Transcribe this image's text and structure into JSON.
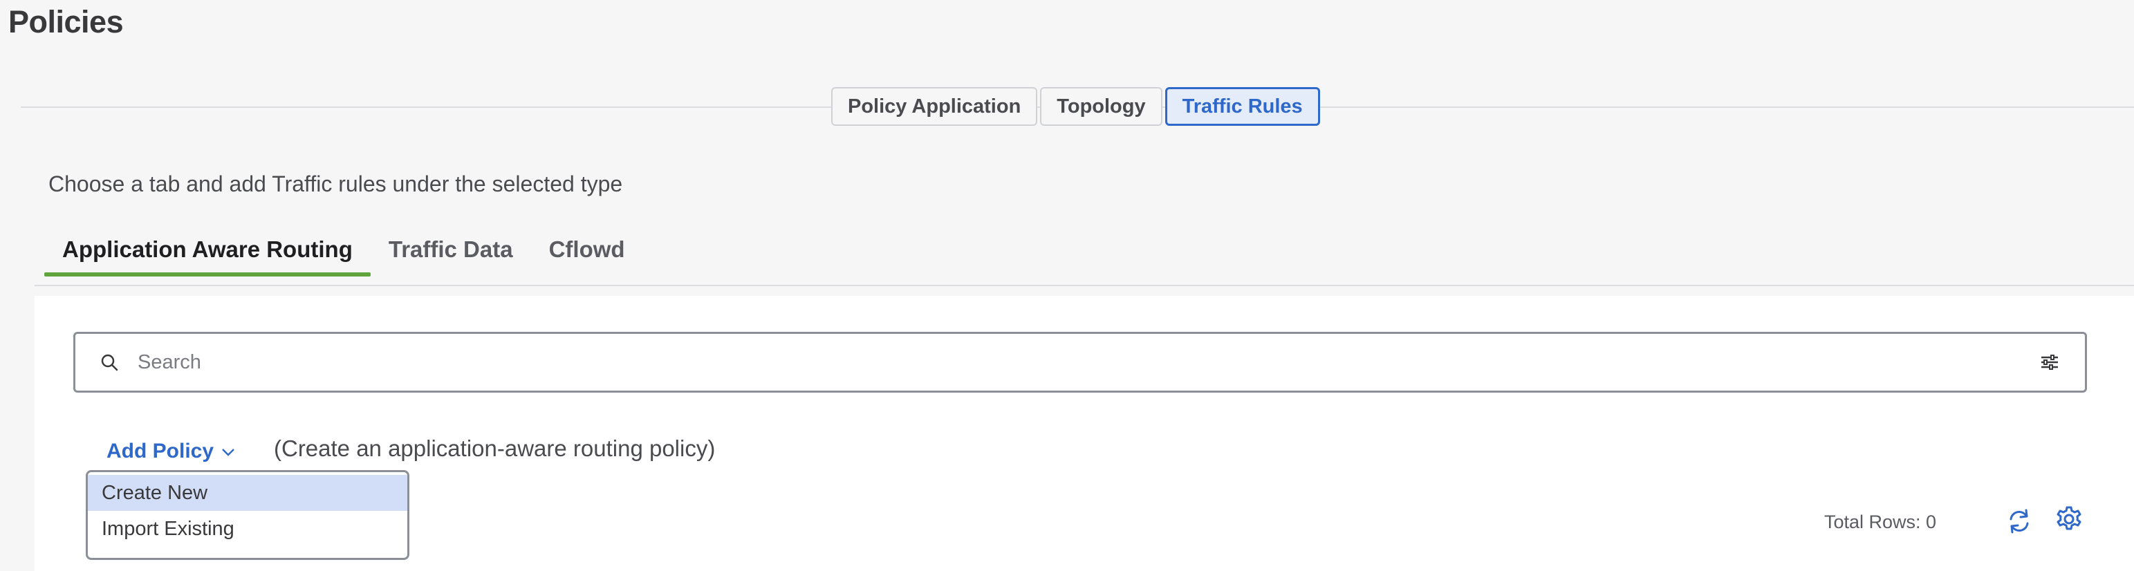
{
  "page": {
    "title": "Policies"
  },
  "segments": [
    {
      "label": "Policy Application",
      "active": false
    },
    {
      "label": "Topology",
      "active": false
    },
    {
      "label": "Traffic Rules",
      "active": true
    }
  ],
  "instructions": "Choose a tab and add Traffic rules under the selected type",
  "subtabs": [
    {
      "label": "Application Aware Routing",
      "active": true
    },
    {
      "label": "Traffic Data",
      "active": false
    },
    {
      "label": "Cflowd",
      "active": false
    }
  ],
  "search": {
    "placeholder": "Search",
    "value": ""
  },
  "add_policy": {
    "label": "Add Policy",
    "description": "(Create an application-aware routing policy)",
    "menu": [
      {
        "label": "Create New",
        "highlighted": true
      },
      {
        "label": "Import Existing",
        "highlighted": false
      }
    ]
  },
  "table": {
    "total_rows": "Total Rows: 0"
  },
  "icons": {
    "search": "search-icon",
    "filter": "filter-icon",
    "chevron": "chevron-down-icon",
    "refresh": "refresh-icon",
    "settings": "gear-icon"
  },
  "colors": {
    "accent": "#2e68c8",
    "active_tab_underline": "#5fa43c",
    "menu_highlight": "#d2def8"
  }
}
